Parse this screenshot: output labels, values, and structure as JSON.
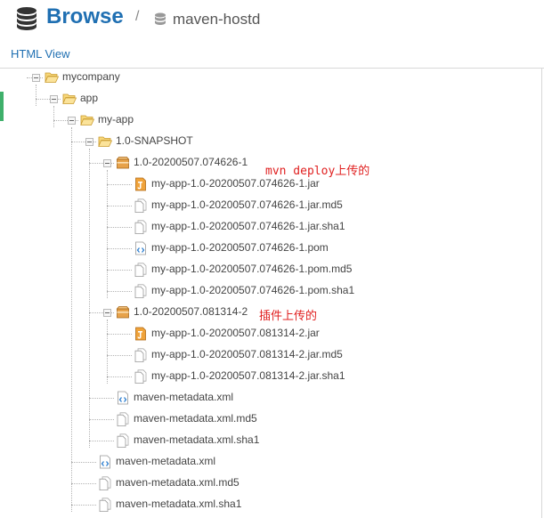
{
  "header": {
    "title": "Browse",
    "separator": "/",
    "repository": "maven-hostd"
  },
  "view_link": "HTML View",
  "tree": [
    {
      "label": "mycompany",
      "icon": "folder-open-icon"
    },
    {
      "label": "app",
      "icon": "folder-open-icon"
    },
    {
      "label": "my-app",
      "icon": "folder-open-icon"
    },
    {
      "label": "1.0-SNAPSHOT",
      "icon": "folder-open-icon"
    },
    {
      "label": "1.0-20200507.074626-1",
      "icon": "package-icon"
    },
    {
      "label": "my-app-1.0-20200507.074626-1.jar",
      "icon": "jar-file-icon"
    },
    {
      "label": "my-app-1.0-20200507.074626-1.jar.md5",
      "icon": "file-icon"
    },
    {
      "label": "my-app-1.0-20200507.074626-1.jar.sha1",
      "icon": "file-icon"
    },
    {
      "label": "my-app-1.0-20200507.074626-1.pom",
      "icon": "xml-file-icon"
    },
    {
      "label": "my-app-1.0-20200507.074626-1.pom.md5",
      "icon": "file-icon"
    },
    {
      "label": "my-app-1.0-20200507.074626-1.pom.sha1",
      "icon": "file-icon"
    },
    {
      "label": "1.0-20200507.081314-2",
      "icon": "package-icon"
    },
    {
      "label": "my-app-1.0-20200507.081314-2.jar",
      "icon": "jar-file-icon"
    },
    {
      "label": "my-app-1.0-20200507.081314-2.jar.md5",
      "icon": "file-icon"
    },
    {
      "label": "my-app-1.0-20200507.081314-2.jar.sha1",
      "icon": "file-icon"
    },
    {
      "label": "maven-metadata.xml",
      "icon": "xml-file-icon"
    },
    {
      "label": "maven-metadata.xml.md5",
      "icon": "file-icon"
    },
    {
      "label": "maven-metadata.xml.sha1",
      "icon": "file-icon"
    },
    {
      "label": "maven-metadata.xml",
      "icon": "xml-file-icon"
    },
    {
      "label": "maven-metadata.xml.md5",
      "icon": "file-icon"
    },
    {
      "label": "maven-metadata.xml.sha1",
      "icon": "file-icon"
    }
  ],
  "annotations": {
    "first": "mvn deploy上传的",
    "second": "插件上传的"
  },
  "colors": {
    "accent": "#1f6fb2",
    "annotation": "#e02020",
    "active_marker": "#3fb06b"
  }
}
